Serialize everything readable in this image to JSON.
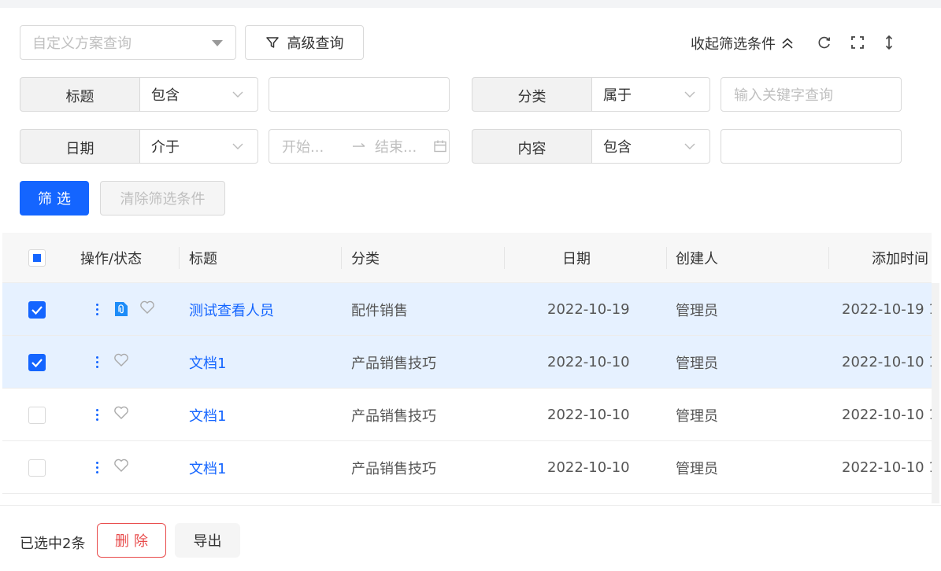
{
  "toolbar": {
    "scheme_placeholder": "自定义方案查询",
    "advanced_query_label": "高级查询",
    "collapse_label": "收起筛选条件"
  },
  "filters": {
    "title": {
      "label": "标题",
      "operator": "包含",
      "value": ""
    },
    "category": {
      "label": "分类",
      "operator": "属于",
      "placeholder": "输入关键字查询"
    },
    "date": {
      "label": "日期",
      "operator": "介于",
      "start_placeholder": "开始...",
      "end_placeholder": "结束..."
    },
    "content": {
      "label": "内容",
      "operator": "包含",
      "value": ""
    },
    "filter_button": "筛选",
    "clear_button": "清除筛选条件"
  },
  "table": {
    "columns": {
      "actions": "操作/状态",
      "title": "标题",
      "category": "分类",
      "date": "日期",
      "creator": "创建人",
      "added_time": "添加时间"
    },
    "rows": [
      {
        "title": "测试查看人员",
        "category": "配件销售",
        "date": "2022-10-19",
        "creator": "管理员",
        "added_time": "2022-10-19 1"
      },
      {
        "title": "文档1",
        "category": "产品销售技巧",
        "date": "2022-10-10",
        "creator": "管理员",
        "added_time": "2022-10-10 1"
      },
      {
        "title": "文档1",
        "category": "产品销售技巧",
        "date": "2022-10-10",
        "creator": "管理员",
        "added_time": "2022-10-10 1"
      },
      {
        "title": "文档1",
        "category": "产品销售技巧",
        "date": "2022-10-10",
        "creator": "管理员",
        "added_time": "2022-10-10 1"
      }
    ]
  },
  "footer": {
    "selected_count": "已选中2条",
    "delete_button": "删除",
    "export_button": "导出"
  },
  "colors": {
    "primary": "#1465ff",
    "danger": "#e84a4a",
    "selected_row": "#e6f1ff"
  }
}
